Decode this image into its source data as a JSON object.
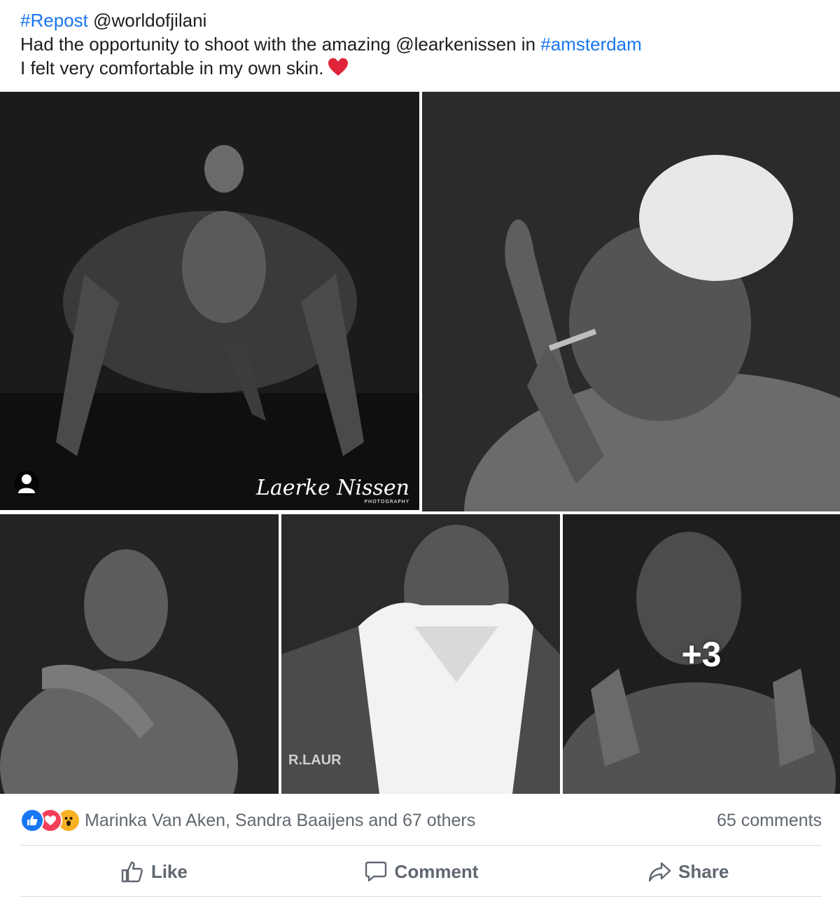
{
  "post": {
    "line1_hashtag": "#Repost",
    "line1_text": " @worldofjilani",
    "line2_text": "Had the opportunity to shoot with the amazing @learkenissen in ",
    "line2_hashtag": "#amsterdam",
    "line3_text": "I felt very comfortable in my own skin.",
    "heart_emoji": "heart-emoji"
  },
  "gallery": {
    "watermark_name": "Laerke Nissen",
    "watermark_sub": "PHOTOGRAPHY",
    "more_count": "+3",
    "photo_prints": {
      "jacket_text": "R.LAUR"
    }
  },
  "reactions": {
    "icons": [
      "like-icon",
      "love-icon",
      "wow-icon"
    ],
    "names": "Marinka Van Aken, Sandra Baaijens and 67 others",
    "comments": "65 comments"
  },
  "actions": {
    "like": "Like",
    "comment": "Comment",
    "share": "Share"
  },
  "colors": {
    "link_blue": "#1877f2",
    "muted_text": "#606770",
    "like_blue": "#1877f2",
    "love_red": "#f33e58",
    "wow_yellow": "#f7b125"
  }
}
